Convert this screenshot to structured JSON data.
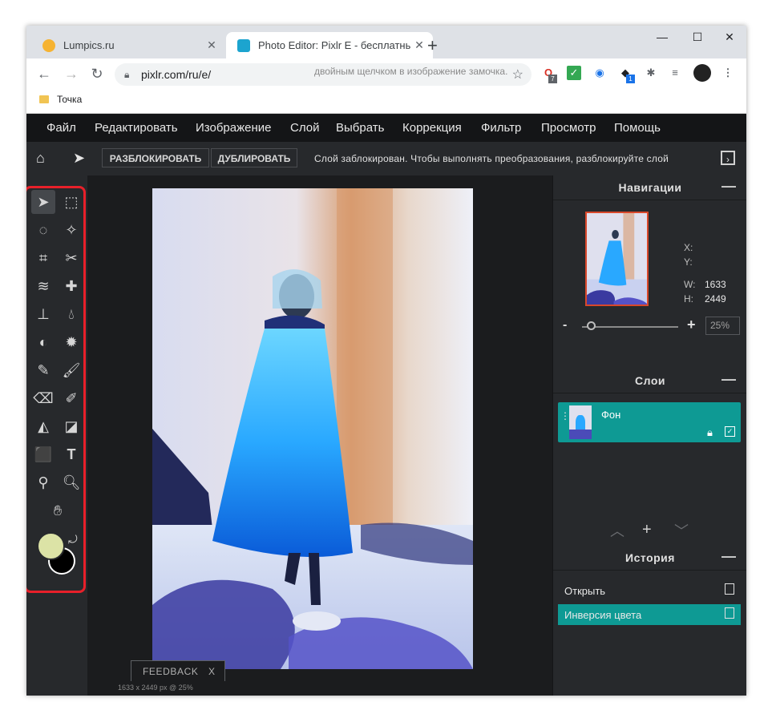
{
  "browser": {
    "tabs": [
      {
        "title": "Lumpics.ru",
        "active": false,
        "favicon_color": "#f6b332"
      },
      {
        "title": "Photo Editor: Pixlr E - бесплатны",
        "active": true,
        "favicon_color": "#1ca4cf"
      }
    ],
    "new_tab_label": "+",
    "address": "pixlr.com/ru/e/",
    "bookmark": "Точка",
    "ext_badges": [
      "7",
      "1"
    ]
  },
  "menu": [
    "Файл",
    "Редактировать",
    "Изображение",
    "Слой",
    "Выбрать",
    "Коррекция",
    "Фильтр",
    "Просмотр",
    "Помощь"
  ],
  "tool_options": {
    "unlock_label": "РАЗБЛОКИРОВАТЬ",
    "duplicate_label": "ДУБЛИРОВАТЬ",
    "message_line1": "Слой заблокирован. Чтобы выполнять преобразования, разблокируйте слой",
    "message_line2": "двойным щелчком в изображение замочка."
  },
  "navigator": {
    "title": "Навигации",
    "x_label": "X:",
    "y_label": "Y:",
    "w_label": "W:",
    "w_value": "1633",
    "h_label": "H:",
    "h_value": "2449",
    "zoom": "25%",
    "minus": "-",
    "plus": "+"
  },
  "layers": {
    "title": "Слои",
    "items": [
      {
        "name": "Фон"
      }
    ]
  },
  "history": {
    "title": "История",
    "items": [
      {
        "label": "Открыть",
        "selected": false
      },
      {
        "label": "Инверсия цвета",
        "selected": true
      }
    ]
  },
  "status": "1633 x 2449 px @ 25%",
  "feedback": {
    "label": "FEEDBACK",
    "close": "X"
  },
  "colors": {
    "accent": "#0e9a94",
    "foreground": "#dce3a6",
    "background": "#000000",
    "highlight": "#e8202a"
  }
}
